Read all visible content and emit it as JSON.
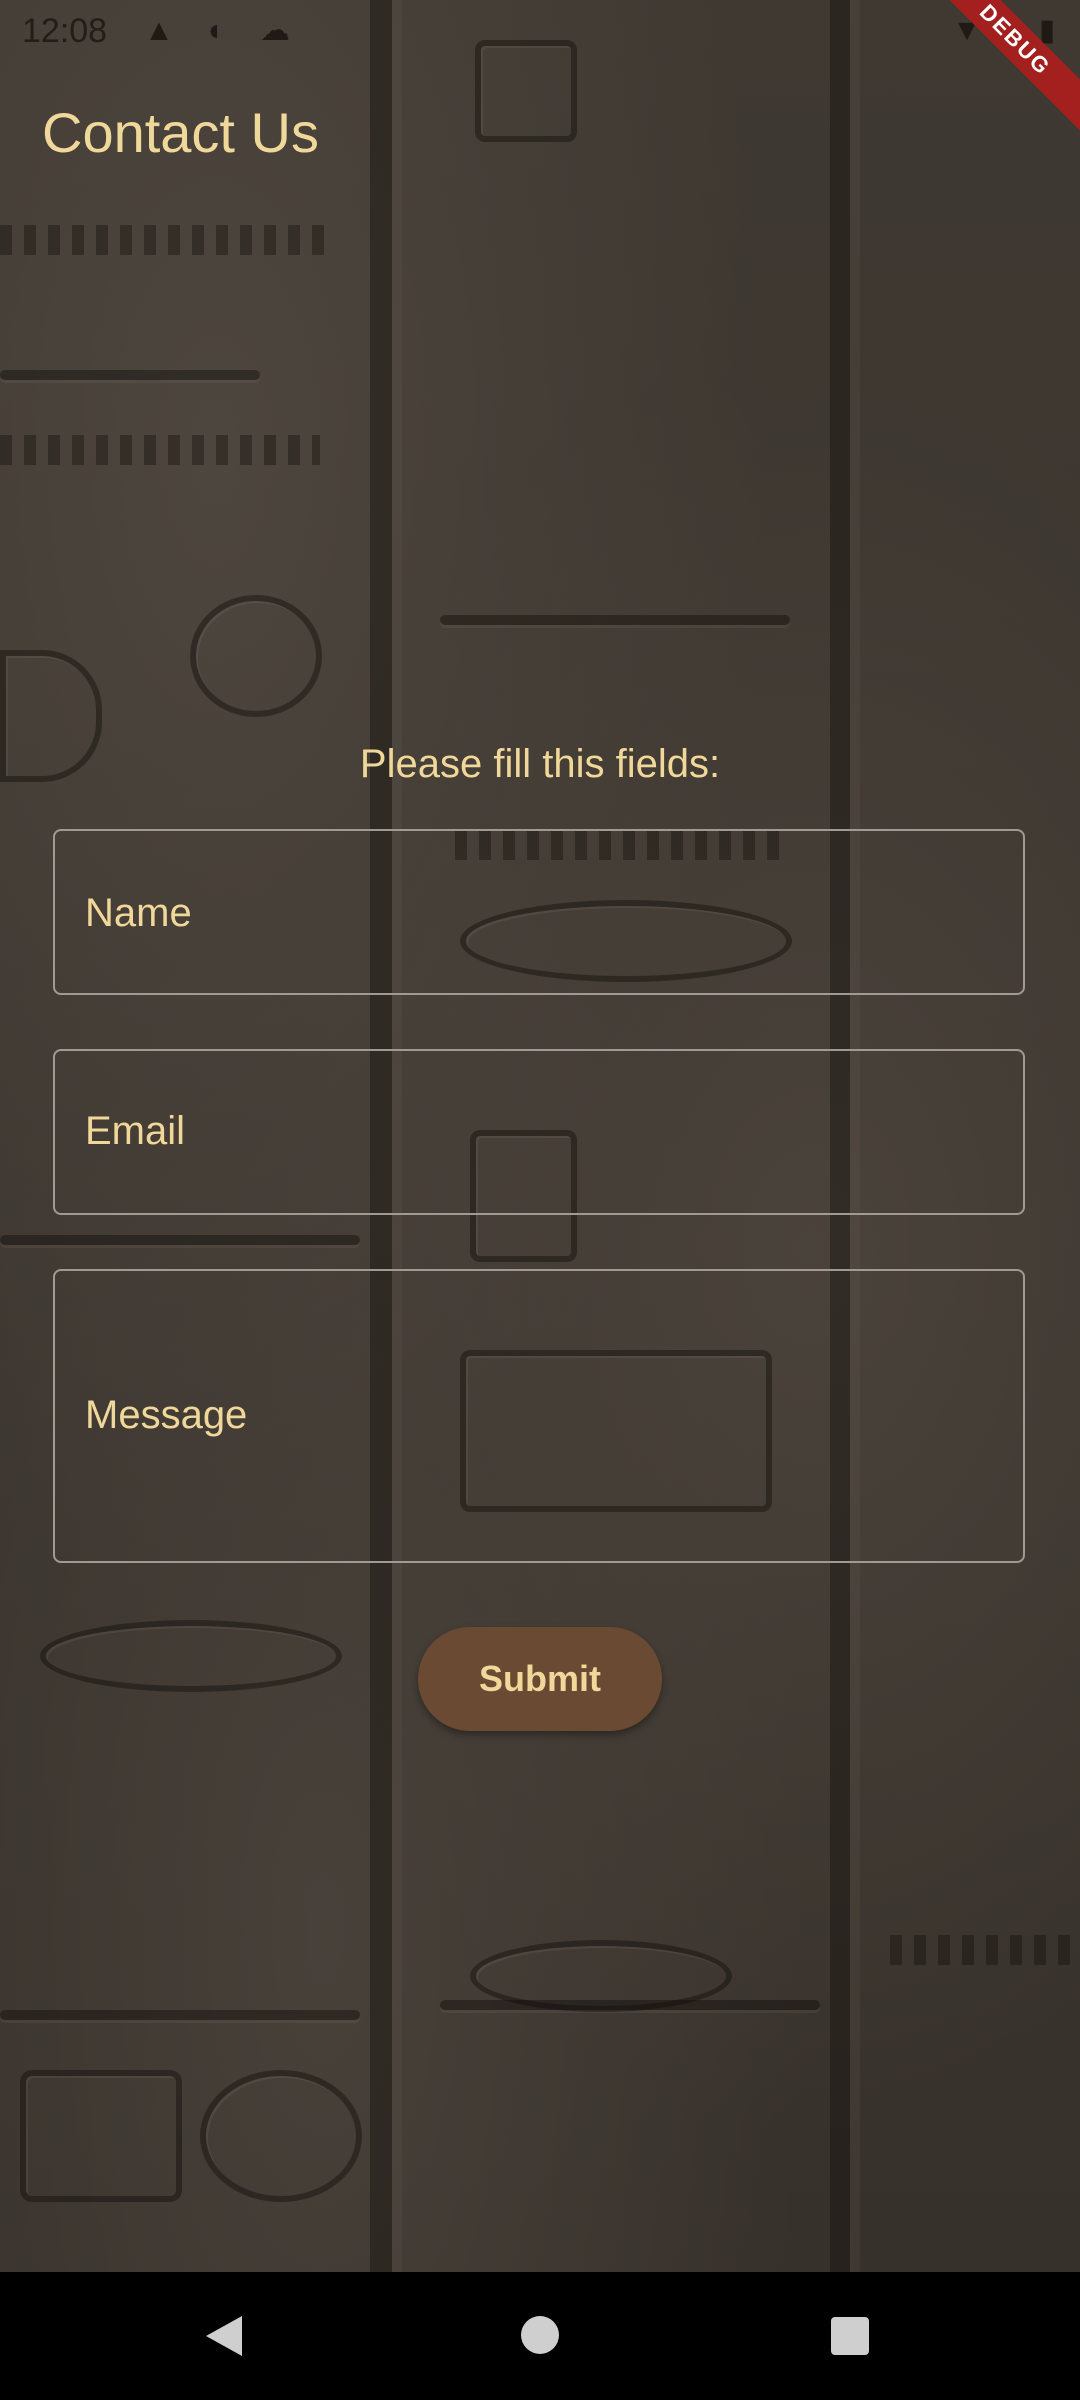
{
  "status_bar": {
    "time": "12:08",
    "icons": [
      "warning-icon",
      "data-saver-icon",
      "cloud-icon",
      "wifi-icon",
      "signal-icon",
      "battery-icon"
    ],
    "debug_banner": "DEBUG"
  },
  "app_bar": {
    "title": "Contact Us"
  },
  "form": {
    "prompt": "Please fill this fields:",
    "name_placeholder": "Name",
    "email_placeholder": "Email",
    "message_placeholder": "Message",
    "submit_label": "Submit"
  },
  "nav_bar": {
    "buttons": [
      "back-icon",
      "home-icon",
      "recents-icon"
    ]
  },
  "colors": {
    "text_accent": "#f0d79a",
    "button_bg": "#6b4a34",
    "field_border": "#a09a93"
  }
}
